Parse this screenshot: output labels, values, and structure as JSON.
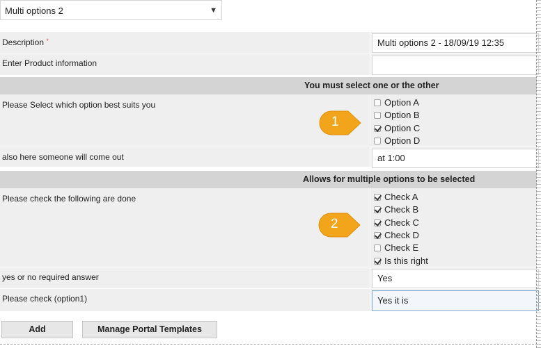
{
  "template_select": {
    "value": "Multi options 2"
  },
  "fields": {
    "description": {
      "label": "Description",
      "required_mark": "*",
      "value": "Multi options 2 - 18/09/19 12:35"
    },
    "product_info": {
      "label": "Enter Product information",
      "value": ""
    }
  },
  "section1": {
    "title": "You must select one or the other",
    "question": "Please Select which option best suits you",
    "options": [
      {
        "label": "Option A",
        "checked": false
      },
      {
        "label": "Option B",
        "checked": false
      },
      {
        "label": "Option C",
        "checked": true
      },
      {
        "label": "Option D",
        "checked": false
      }
    ],
    "followup": {
      "label": "also here someone will come out",
      "value": "at 1:00"
    },
    "callout": "1"
  },
  "section2": {
    "title": "Allows for multiple options to be selected",
    "question": "Please check the following are done",
    "options": [
      {
        "label": "Check A",
        "checked": true
      },
      {
        "label": "Check B",
        "checked": true
      },
      {
        "label": "Check C",
        "checked": true
      },
      {
        "label": "Check D",
        "checked": true
      },
      {
        "label": "Check E",
        "checked": false
      },
      {
        "label": "Is this right",
        "checked": true
      }
    ],
    "yes_no": {
      "label": "yes or no required answer",
      "value": "Yes"
    },
    "please_check": {
      "label": "Please check (option1)",
      "value": "Yes it is"
    },
    "callout": "2"
  },
  "buttons": {
    "add": "Add",
    "manage": "Manage Portal Templates"
  },
  "colors": {
    "callout": "#f2a51a",
    "section_header": "#d4d4d4",
    "row_bg": "#efefef"
  }
}
